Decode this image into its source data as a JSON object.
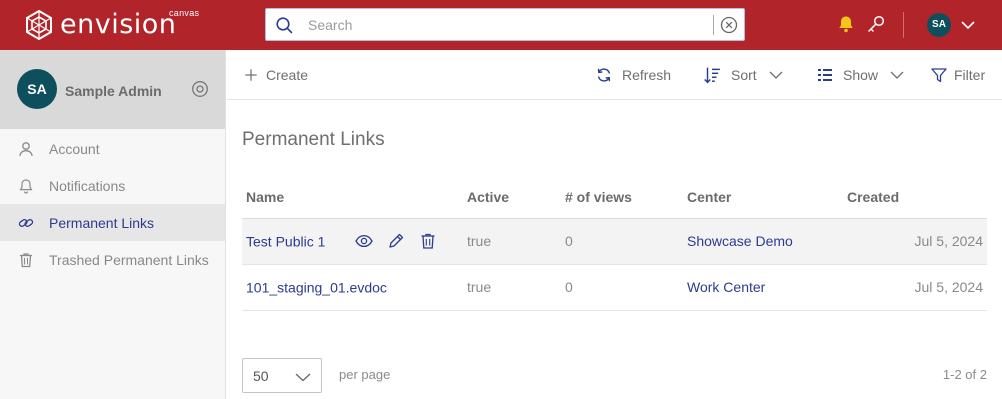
{
  "brand": {
    "name": "envision",
    "sub": "canvas",
    "color": "#b0242a"
  },
  "header": {
    "search_placeholder": "Search",
    "user_initials": "SA"
  },
  "sidebar": {
    "profile_name": "Sample Admin",
    "profile_initials": "SA",
    "items": [
      {
        "label": "Account",
        "icon": "user-icon"
      },
      {
        "label": "Notifications",
        "icon": "bell-icon"
      },
      {
        "label": "Permanent Links",
        "icon": "link-icon",
        "active": true
      },
      {
        "label": "Trashed Permanent Links",
        "icon": "trash-icon"
      }
    ]
  },
  "toolbar": {
    "create_label": "Create",
    "refresh_label": "Refresh",
    "sort_label": "Sort",
    "show_label": "Show",
    "filter_label": "Filter"
  },
  "page": {
    "title": "Permanent Links"
  },
  "table": {
    "columns": [
      "Name",
      "Active",
      "# of views",
      "Center",
      "Created"
    ],
    "rows": [
      {
        "name": "Test Public 1",
        "active": "true",
        "views": "0",
        "center": "Showcase Demo",
        "created": "Jul 5, 2024"
      },
      {
        "name": "101_staging_01.evdoc",
        "active": "true",
        "views": "0",
        "center": "Work Center",
        "created": "Jul 5, 2024"
      }
    ]
  },
  "footer": {
    "per_page_value": "50",
    "per_page_label": "per page",
    "range": "1-2 of 2"
  }
}
